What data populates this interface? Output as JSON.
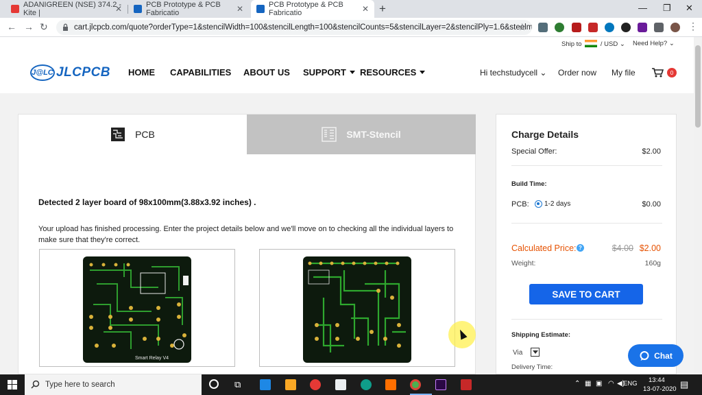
{
  "browser": {
    "tabs": [
      {
        "title": "ADANIGREEN (NSE) 374.2 - Kite |",
        "active": false
      },
      {
        "title": "PCB Prototype & PCB Fabricatio",
        "active": false
      },
      {
        "title": "PCB Prototype & PCB Fabricatio",
        "active": true
      }
    ],
    "url": "cart.jlcpcb.com/quote?orderType=1&stencilWidth=100&stencilLength=100&stencilCounts=5&stencilLayer=2&stencilPly=1.6&steelmes..."
  },
  "header": {
    "ship_to": "Ship to",
    "currency": "/ USD",
    "need_help": "Need Help?",
    "logo_badge": "J@LC",
    "logo_text": "JLCPCB",
    "nav": [
      "HOME",
      "CAPABILITIES",
      "ABOUT US",
      "SUPPORT",
      "RESOURCES"
    ],
    "user": "Hi techstudycell",
    "order_now": "Order now",
    "my_file": "My file",
    "cart_count": "0"
  },
  "main": {
    "tab_pcb": "PCB",
    "tab_smt": "SMT-Stencil",
    "detected": "Detected 2 layer board of 98x100mm(3.88x3.92 inches) .",
    "upload_msg": "Your upload has finished processing. Enter the project details below and we'll move on to checking all the individual layers to make sure that they're correct.",
    "board_label": "Smart Relay V4"
  },
  "charge": {
    "title": "Charge Details",
    "special_offer_label": "Special Offer:",
    "special_offer_value": "$2.00",
    "build_time_label": "Build Time:",
    "pcb_label": "PCB:",
    "pcb_days": "1-2 days",
    "pcb_value": "$0.00",
    "calculated_label": "Calculated Price:",
    "old_price": "$4.00",
    "new_price": "$2.00",
    "weight_label": "Weight:",
    "weight_value": "160g",
    "save_to_cart": "SAVE TO CART",
    "shipping_estimate": "Shipping Estimate:",
    "via": "Via",
    "delivery_time": "Delivery Time:"
  },
  "chat": {
    "label": "Chat"
  },
  "taskbar": {
    "search_placeholder": "Type here to search",
    "lang": "ENG",
    "time": "13:44",
    "date": "13-07-2020"
  },
  "colors": {
    "accent": "#1565e8",
    "price_orange": "#e65100",
    "brand_blue": "#1565c0"
  }
}
